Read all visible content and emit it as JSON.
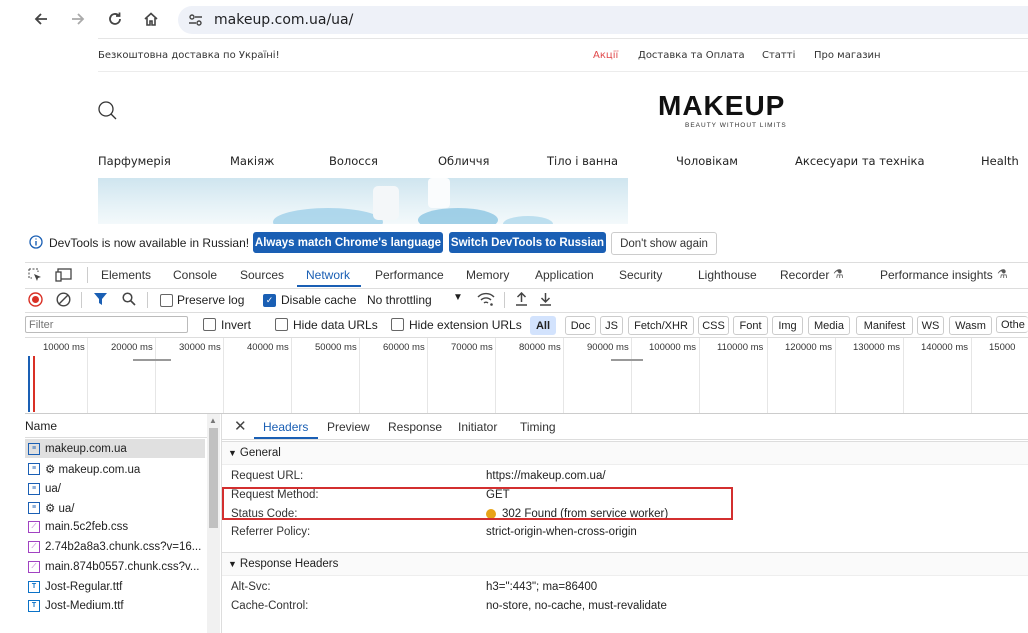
{
  "browser": {
    "url": "makeup.com.ua/ua/"
  },
  "site": {
    "promo": "Безкоштовна доставка по Україні!",
    "top_links": [
      "Акції",
      "Доставка та Оплата",
      "Статті",
      "Про магазин"
    ],
    "logo": "MAKEUP",
    "tagline": "BEAUTY WITHOUT LIMITS",
    "categories": [
      "Парфумерія",
      "Макіяж",
      "Волосся",
      "Обличчя",
      "Тіло і ванна",
      "Чоловікам",
      "Аксесуари та техніка",
      "Health"
    ],
    "accent_color": "#e0484a"
  },
  "infobar": {
    "message": "DevTools is now available in Russian!",
    "btn_match": "Always match Chrome's language",
    "btn_switch": "Switch DevTools to Russian",
    "btn_dismiss": "Don't show again"
  },
  "devtools": {
    "tabs": [
      "Elements",
      "Console",
      "Sources",
      "Network",
      "Performance",
      "Memory",
      "Application",
      "Security",
      "Lighthouse",
      "Recorder",
      "Performance insights"
    ],
    "active_tab": "Network",
    "toolbar": {
      "preserve_log": "Preserve log",
      "disable_cache": "Disable cache",
      "throttling": "No throttling"
    },
    "filter": {
      "placeholder": "Filter",
      "invert": "Invert",
      "hide_data_urls": "Hide data URLs",
      "hide_ext_urls": "Hide extension URLs",
      "types": [
        "All",
        "Doc",
        "JS",
        "Fetch/XHR",
        "CSS",
        "Font",
        "Img",
        "Media",
        "Manifest",
        "WS",
        "Wasm",
        "Othe"
      ]
    },
    "timeline_ticks": [
      "10000 ms",
      "20000 ms",
      "30000 ms",
      "40000 ms",
      "50000 ms",
      "60000 ms",
      "70000 ms",
      "80000 ms",
      "90000 ms",
      "100000 ms",
      "110000 ms",
      "120000 ms",
      "130000 ms",
      "140000 ms",
      "15000"
    ],
    "name_header": "Name",
    "requests": [
      {
        "name": "makeup.com.ua",
        "type": "doc"
      },
      {
        "name": "⚙ makeup.com.ua",
        "type": "doc"
      },
      {
        "name": "ua/",
        "type": "doc"
      },
      {
        "name": "⚙ ua/",
        "type": "doc"
      },
      {
        "name": "main.5c2feb.css",
        "type": "css"
      },
      {
        "name": "2.74b2a8a3.chunk.css?v=16...",
        "type": "css"
      },
      {
        "name": "main.874b0557.chunk.css?v...",
        "type": "css"
      },
      {
        "name": "Jost-Regular.ttf",
        "type": "font"
      },
      {
        "name": "Jost-Medium.ttf",
        "type": "font"
      }
    ],
    "detail_tabs": [
      "Headers",
      "Preview",
      "Response",
      "Initiator",
      "Timing"
    ],
    "general_title": "General",
    "general": [
      {
        "k": "Request URL:",
        "v": "https://makeup.com.ua/"
      },
      {
        "k": "Request Method:",
        "v": "GET"
      },
      {
        "k": "Status Code:",
        "v": "302 Found (from service worker)"
      },
      {
        "k": "Referrer Policy:",
        "v": "strict-origin-when-cross-origin"
      }
    ],
    "response_title": "Response Headers",
    "response": [
      {
        "k": "Alt-Svc:",
        "v": "h3=\":443\"; ma=86400"
      },
      {
        "k": "Cache-Control:",
        "v": "no-store, no-cache, must-revalidate"
      }
    ],
    "status_color": "#e8a317",
    "highlight_color": "#d32f2f"
  }
}
